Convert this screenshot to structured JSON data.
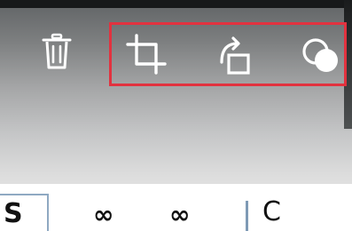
{
  "toolbar": {
    "delete": {
      "icon": "trash-icon"
    },
    "crop": {
      "icon": "crop-icon"
    },
    "rotate": {
      "icon": "rotate-icon"
    },
    "filters": {
      "icon": "filter-circles-icon"
    }
  },
  "highlight": {
    "color": "#e2323f"
  },
  "filmstrip": {
    "items": [
      "S",
      "∞",
      "∞",
      "C"
    ]
  }
}
